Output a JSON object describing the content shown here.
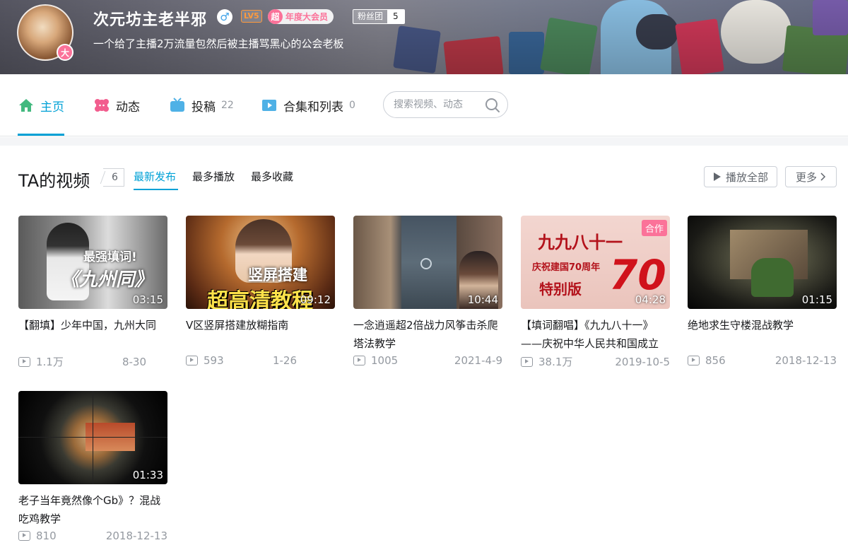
{
  "profile": {
    "username": "次元坊主老半邪",
    "gender_symbol": "♂",
    "level": "LV5",
    "avatar_badge": "大",
    "vip_icon": "超",
    "vip_label": "年度大会员",
    "fans_label": "粉丝团",
    "fans_count": "5",
    "sign": "一个给了主播2万流量包然后被主播骂黑心的公会老板"
  },
  "nav": {
    "home": "主页",
    "dynamic": "动态",
    "uploads": "投稿",
    "uploads_count": "22",
    "collections": "合集和列表",
    "collections_count": "0",
    "search_placeholder": "搜索视频、动态"
  },
  "section": {
    "title": "TA的视频",
    "count": "6",
    "tabs": [
      "最新发布",
      "最多播放",
      "最多收藏"
    ],
    "play_all": "播放全部",
    "more": "更多"
  },
  "videos": [
    {
      "title": "【翻填】少年中国，九州大同",
      "duration": "03:15",
      "plays": "1.1万",
      "date": "8-30",
      "thumb_text": [
        "最强填词!",
        "《九州同》"
      ]
    },
    {
      "title": "V区竖屏搭建放糊指南",
      "duration": "09:12",
      "plays": "593",
      "date": "1-26",
      "thumb_text": [
        "竖屏搭建",
        "超高清教程"
      ]
    },
    {
      "title": "一念逍遥超2倍战力风筝击杀爬塔法教学",
      "duration": "10:44",
      "plays": "1005",
      "date": "2021-4-9",
      "thumb_text": []
    },
    {
      "title": "【填词翻唱】《九九八十一》——庆祝中华人民共和国成立",
      "duration": "04:28",
      "plays": "38.1万",
      "date": "2019-10-5",
      "badge": "合作",
      "thumb_text": [
        "九九八十一",
        "庆祝建国70周年",
        "特别版",
        "70"
      ]
    },
    {
      "title": "绝地求生守楼混战教学",
      "duration": "01:15",
      "plays": "856",
      "date": "2018-12-13",
      "thumb_text": []
    },
    {
      "title": "老子当年竟然像个Gb》？混战吃鸡教学",
      "duration": "01:33",
      "plays": "810",
      "date": "2018-12-13",
      "thumb_text": []
    }
  ],
  "colors": {
    "accent": "#00a1d6",
    "pink": "#fb7299",
    "muted": "#9499a0"
  }
}
